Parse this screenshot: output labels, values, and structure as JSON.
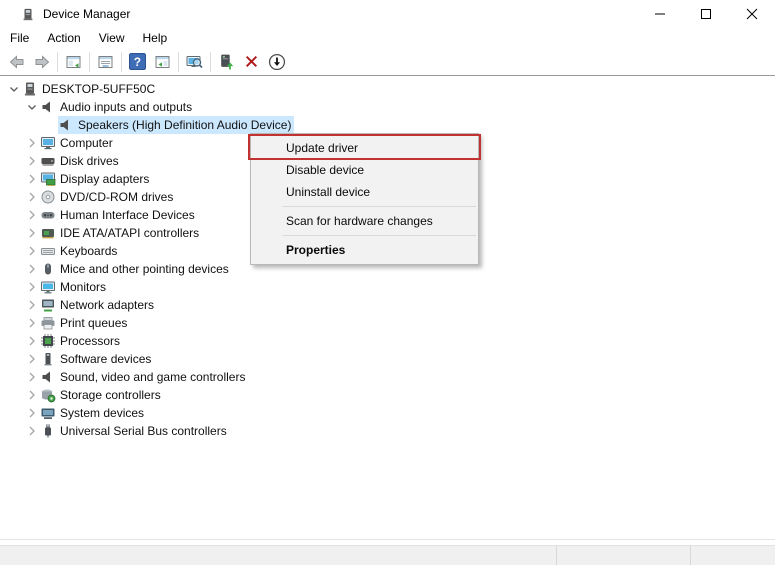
{
  "window": {
    "title": "Device Manager"
  },
  "menu_bar": {
    "items": [
      "File",
      "Action",
      "View",
      "Help"
    ]
  },
  "toolbar": {
    "buttons": [
      "back",
      "forward",
      "show-hide-console-tree",
      "properties",
      "help",
      "show-hide-action-pane",
      "scan-for-hardware-changes",
      "update-driver",
      "uninstall-device",
      "disable-device"
    ]
  },
  "tree": {
    "items": [
      {
        "label": "DESKTOP-5UFF50C",
        "level": 0,
        "expander": "expanded",
        "icon": "computer-root",
        "selected": false
      },
      {
        "label": "Audio inputs and outputs",
        "level": 1,
        "expander": "expanded",
        "icon": "speaker",
        "selected": false
      },
      {
        "label": "Speakers (High Definition Audio Device)",
        "level": 2,
        "expander": "none",
        "icon": "speaker",
        "selected": true
      },
      {
        "label": "Computer",
        "level": 1,
        "expander": "collapsed",
        "icon": "monitor",
        "selected": false
      },
      {
        "label": "Disk drives",
        "level": 1,
        "expander": "collapsed",
        "icon": "hdd",
        "selected": false
      },
      {
        "label": "Display adapters",
        "level": 1,
        "expander": "collapsed",
        "icon": "display-adapter",
        "selected": false
      },
      {
        "label": "DVD/CD-ROM drives",
        "level": 1,
        "expander": "collapsed",
        "icon": "disc",
        "selected": false
      },
      {
        "label": "Human Interface Devices",
        "level": 1,
        "expander": "collapsed",
        "icon": "hid",
        "selected": false
      },
      {
        "label": "IDE ATA/ATAPI controllers",
        "level": 1,
        "expander": "collapsed",
        "icon": "ide",
        "selected": false
      },
      {
        "label": "Keyboards",
        "level": 1,
        "expander": "collapsed",
        "icon": "keyboard",
        "selected": false
      },
      {
        "label": "Mice and other pointing devices",
        "level": 1,
        "expander": "collapsed",
        "icon": "mouse",
        "selected": false
      },
      {
        "label": "Monitors",
        "level": 1,
        "expander": "collapsed",
        "icon": "monitor2",
        "selected": false
      },
      {
        "label": "Network adapters",
        "level": 1,
        "expander": "collapsed",
        "icon": "network",
        "selected": false
      },
      {
        "label": "Print queues",
        "level": 1,
        "expander": "collapsed",
        "icon": "printer",
        "selected": false
      },
      {
        "label": "Processors",
        "level": 1,
        "expander": "collapsed",
        "icon": "processor",
        "selected": false
      },
      {
        "label": "Software devices",
        "level": 1,
        "expander": "collapsed",
        "icon": "software",
        "selected": false
      },
      {
        "label": "Sound, video and game controllers",
        "level": 1,
        "expander": "collapsed",
        "icon": "speaker",
        "selected": false
      },
      {
        "label": "Storage controllers",
        "level": 1,
        "expander": "collapsed",
        "icon": "storage",
        "selected": false
      },
      {
        "label": "System devices",
        "level": 1,
        "expander": "collapsed",
        "icon": "system",
        "selected": false
      },
      {
        "label": "Universal Serial Bus controllers",
        "level": 1,
        "expander": "collapsed",
        "icon": "usb",
        "selected": false
      }
    ]
  },
  "context_menu": {
    "items": [
      {
        "label": "Update driver",
        "bold": false,
        "separator_after": false,
        "highlighted": true
      },
      {
        "label": "Disable device",
        "bold": false,
        "separator_after": false,
        "highlighted": false
      },
      {
        "label": "Uninstall device",
        "bold": false,
        "separator_after": true,
        "highlighted": false
      },
      {
        "label": "Scan for hardware changes",
        "bold": false,
        "separator_after": true,
        "highlighted": false
      },
      {
        "label": "Properties",
        "bold": true,
        "separator_after": false,
        "highlighted": false
      }
    ]
  },
  "colors": {
    "selection_highlight": "#cce8ff",
    "annotation_red": "#c23231",
    "menu_background": "#f2f2f2",
    "bottom_bar": "#f0f0f0"
  }
}
